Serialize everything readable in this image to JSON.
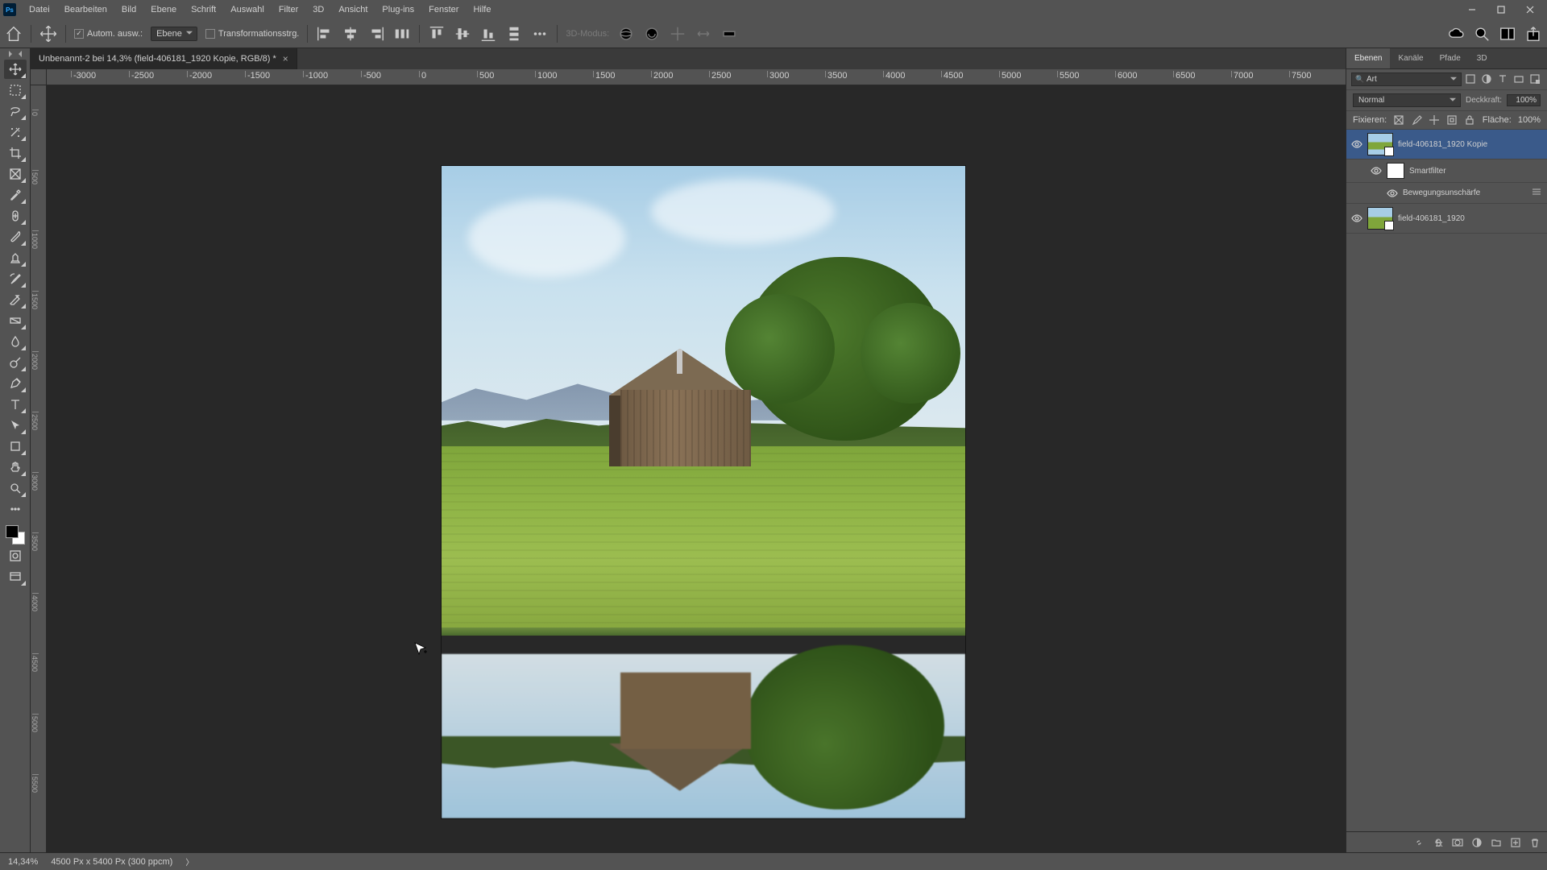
{
  "menu": {
    "items": [
      "Datei",
      "Bearbeiten",
      "Bild",
      "Ebene",
      "Schrift",
      "Auswahl",
      "Filter",
      "3D",
      "Ansicht",
      "Plug-ins",
      "Fenster",
      "Hilfe"
    ]
  },
  "options": {
    "auto_select": "Autom. ausw.:",
    "layer_select": "Ebene",
    "transform_ctrl": "Transformationsstrg.",
    "mode_label": "3D-Modus:"
  },
  "document": {
    "tab_title": "Unbenannt-2 bei 14,3% (field-406181_1920 Kopie, RGB/8) *"
  },
  "rulers": {
    "h": [
      "-3000",
      "-2500",
      "-2000",
      "-1500",
      "-1000",
      "-500",
      "0",
      "500",
      "1000",
      "1500",
      "2000",
      "2500",
      "3000",
      "3500",
      "4000",
      "4500",
      "5000",
      "5500",
      "6000",
      "6500",
      "7000",
      "7500"
    ],
    "v": [
      "0",
      "500",
      "1000",
      "1500",
      "2000",
      "2500",
      "3000",
      "3500",
      "4000",
      "4500",
      "5000",
      "5500"
    ]
  },
  "panel": {
    "tabs": [
      "Ebenen",
      "Kanäle",
      "Pfade",
      "3D"
    ],
    "search_kind": "Art",
    "blend_mode": "Normal",
    "opacity_label": "Deckkraft:",
    "opacity_value": "100%",
    "lock_label": "Fixieren:",
    "fill_label": "Fläche:",
    "fill_value": "100%"
  },
  "layers": [
    {
      "name": "field-406181_1920 Kopie",
      "selected": true,
      "smart": true
    },
    {
      "name": "Smartfilter",
      "indent": 1,
      "mask": true
    },
    {
      "name": "Bewegungsunschärfe",
      "indent": 2,
      "sf": true
    },
    {
      "name": "field-406181_1920",
      "smart": true
    }
  ],
  "status": {
    "zoom": "14,34%",
    "info": "4500 Px x 5400 Px (300 ppcm)"
  }
}
